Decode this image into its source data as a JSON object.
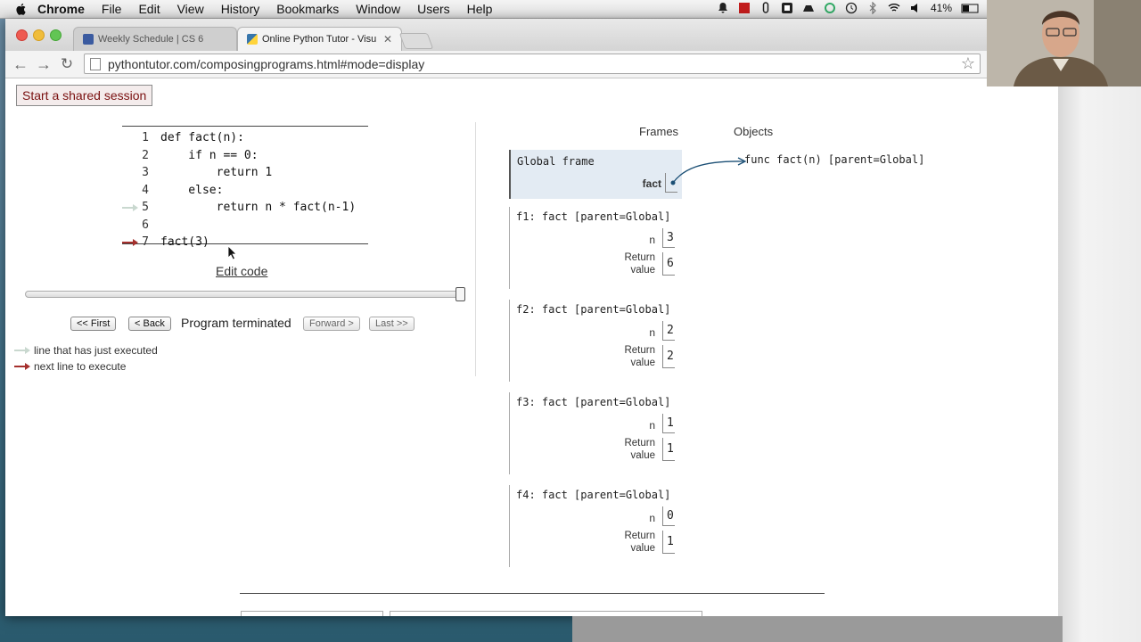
{
  "menubar": {
    "app": "Chrome",
    "items": [
      "File",
      "Edit",
      "View",
      "History",
      "Bookmarks",
      "Window",
      "Users",
      "Help"
    ],
    "battery": "41%"
  },
  "tabs": [
    {
      "title": "Weekly Schedule | CS 6",
      "active": false
    },
    {
      "title": "Online Python Tutor - Visu",
      "active": true
    }
  ],
  "url": "pythontutor.com/composingprograms.html#mode=display",
  "share_button": "Start a shared session",
  "code": [
    {
      "n": "1",
      "text": "def fact(n):"
    },
    {
      "n": "2",
      "text": "    if n == 0:"
    },
    {
      "n": "3",
      "text": "        return 1"
    },
    {
      "n": "4",
      "text": "    else:"
    },
    {
      "n": "5",
      "text": "        return n * fact(n-1)"
    },
    {
      "n": "6",
      "text": ""
    },
    {
      "n": "7",
      "text": "fact(3)"
    }
  ],
  "edit_code": "Edit code",
  "controls": {
    "first": "<< First",
    "back": "< Back",
    "status": "Program terminated",
    "forward": "Forward >",
    "last": "Last >>",
    "step_progress": 1.0
  },
  "legend": {
    "executed": "line that has just executed",
    "next": "next line to execute"
  },
  "viz": {
    "frames_header": "Frames",
    "objects_header": "Objects",
    "global_frame": {
      "title": "Global frame",
      "var": "fact"
    },
    "function_object": "func fact(n) [parent=Global]",
    "frames": [
      {
        "title": "f1: fact [parent=Global]",
        "n": "3",
        "return_label": "Return value",
        "return_value": "6"
      },
      {
        "title": "f2: fact [parent=Global]",
        "n": "2",
        "return_label": "Return value",
        "return_value": "2"
      },
      {
        "title": "f3: fact [parent=Global]",
        "n": "1",
        "return_label": "Return value",
        "return_value": "1"
      },
      {
        "title": "f4: fact [parent=Global]",
        "n": "0",
        "return_label": "Return value",
        "return_value": "1"
      }
    ],
    "n_label": "n"
  },
  "colors": {
    "executed_arrow": "#c9d8cf",
    "next_arrow": "#a5302d",
    "global_frame_bg": "#e3ebf3"
  }
}
